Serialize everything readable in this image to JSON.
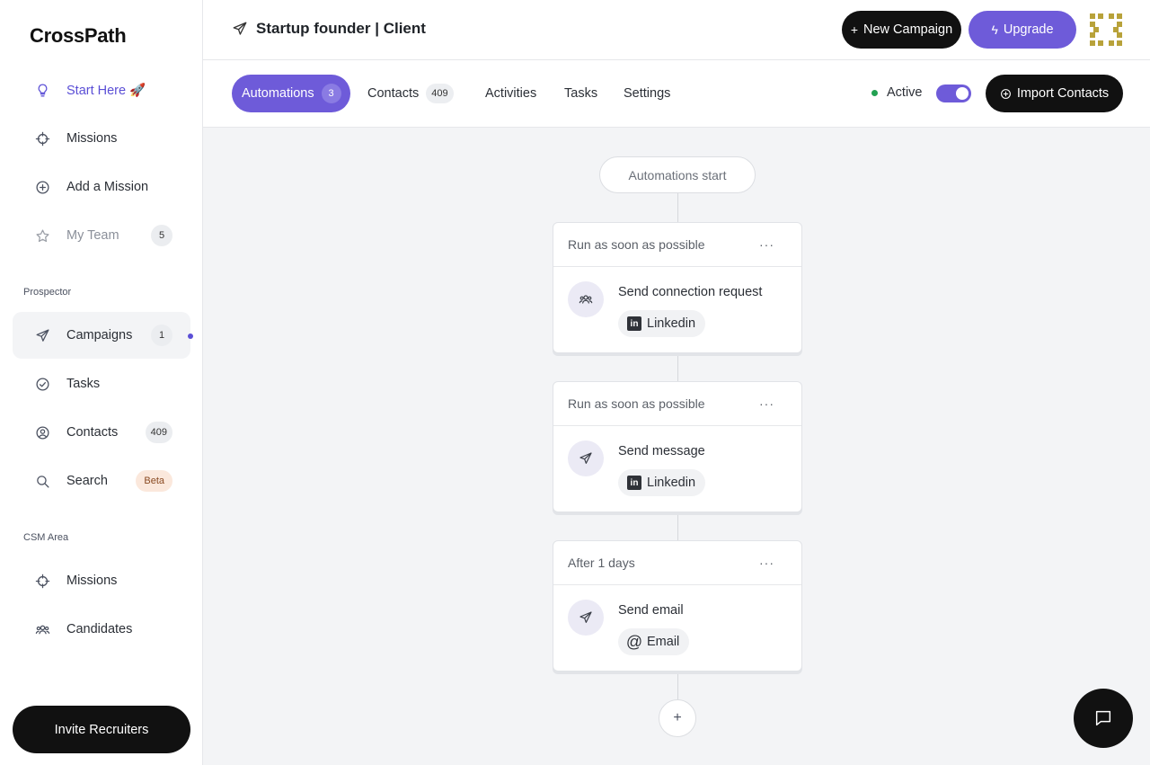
{
  "app": {
    "logo": "CrossPath"
  },
  "sidebar": {
    "items": [
      {
        "label": "Start Here 🚀",
        "icon": "lightbulb-icon"
      },
      {
        "label": "Missions",
        "icon": "crosshair-icon"
      },
      {
        "label": "Add a Mission",
        "icon": "plus-circle-icon"
      },
      {
        "label": "My Team",
        "icon": "star-icon",
        "badge": "5"
      }
    ],
    "sections": [
      {
        "label": "Prospector",
        "items": [
          {
            "label": "Campaigns",
            "icon": "send-icon",
            "badge": "1"
          },
          {
            "label": "Tasks",
            "icon": "check-circle-icon"
          },
          {
            "label": "Contacts",
            "icon": "user-circle-icon",
            "badge": "409"
          },
          {
            "label": "Search",
            "icon": "search-icon",
            "badge": "Beta"
          }
        ]
      },
      {
        "label": "CSM Area",
        "items": [
          {
            "label": "Missions",
            "icon": "crosshair-icon"
          },
          {
            "label": "Candidates",
            "icon": "users-icon"
          }
        ]
      }
    ],
    "invite_label": "Invite Recruiters"
  },
  "header": {
    "title": "Startup founder | Client",
    "new_campaign_label": "New Campaign",
    "upgrade_label": "Upgrade"
  },
  "subnav": {
    "tabs": [
      {
        "label": "Automations",
        "badge": "3"
      },
      {
        "label": "Contacts",
        "badge": "409"
      },
      {
        "label": "Activities"
      },
      {
        "label": "Tasks"
      },
      {
        "label": "Settings"
      }
    ],
    "status_label": "Active",
    "active_on": true,
    "import_label": "Import Contacts"
  },
  "flow": {
    "start_label": "Automations start",
    "steps": [
      {
        "timing": "Run as soon as possible",
        "action": "Send connection request",
        "channel": "Linkedin",
        "icon": "users-icon"
      },
      {
        "timing": "Run as soon as possible",
        "action": "Send message",
        "channel": "Linkedin",
        "icon": "send-icon"
      },
      {
        "timing": "After 1 days",
        "action": "Send email",
        "channel": "Email",
        "icon": "send-icon"
      }
    ]
  },
  "colors": {
    "accent": "#6e5bd9",
    "dark": "#111111",
    "status_green": "#22a152"
  }
}
